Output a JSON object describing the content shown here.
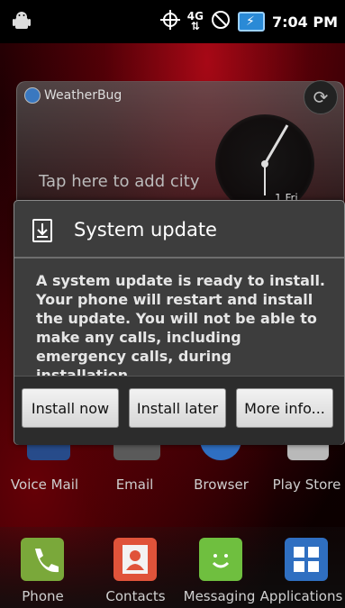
{
  "status_bar": {
    "time": "7:04 PM",
    "network": "4G",
    "icons": [
      "android-debug-icon",
      "gps-icon",
      "4g-signal-icon",
      "no-sync-icon",
      "battery-charging-icon"
    ]
  },
  "weather_widget": {
    "brand": "WeatherBug",
    "city_prompt": "Tap here to add city",
    "date_fragment": "1 Fri"
  },
  "home_apps": [
    {
      "label": "Voice Mail"
    },
    {
      "label": "Email"
    },
    {
      "label": "Browser"
    },
    {
      "label": "Play Store"
    }
  ],
  "dock": [
    {
      "label": "Phone",
      "color": "#7aa83a"
    },
    {
      "label": "Contacts",
      "color": "#e0533a"
    },
    {
      "label": "Messaging",
      "color": "#6fbf3f"
    },
    {
      "label": "Applications",
      "color": "#2f6fc1"
    }
  ],
  "dialog": {
    "title": "System update",
    "message": "A system update is ready to install. Your phone will restart and install the update. You will not be able to make any calls, including emergency calls, during installation.",
    "buttons": {
      "install_now": "Install now",
      "install_later": "Install later",
      "more_info": "More info..."
    }
  }
}
